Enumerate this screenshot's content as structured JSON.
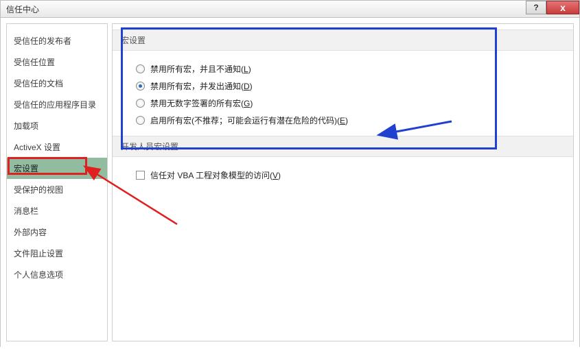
{
  "titlebar": {
    "title": "信任中心",
    "help": "?",
    "close": "x"
  },
  "sidebar": {
    "items": [
      {
        "label": "受信任的发布者"
      },
      {
        "label": "受信任位置"
      },
      {
        "label": "受信任的文档"
      },
      {
        "label": "受信任的应用程序目录"
      },
      {
        "label": "加载项"
      },
      {
        "label": "ActiveX 设置"
      },
      {
        "label": "宏设置"
      },
      {
        "label": "受保护的视图"
      },
      {
        "label": "消息栏"
      },
      {
        "label": "外部内容"
      },
      {
        "label": "文件阻止设置"
      },
      {
        "label": "个人信息选项"
      }
    ],
    "selected_index": 6
  },
  "macro_group": {
    "header": "宏设置",
    "options": [
      {
        "text": "禁用所有宏，并且不通知",
        "hotkey": "L"
      },
      {
        "text": "禁用所有宏，并发出通知",
        "hotkey": "D"
      },
      {
        "text": "禁用无数字签署的所有宏",
        "hotkey": "G"
      },
      {
        "text": "启用所有宏(不推荐；可能会运行有潜在危险的代码)",
        "hotkey": "E"
      }
    ],
    "selected_index": 1
  },
  "dev_group": {
    "header": "开发人员宏设置",
    "checkbox": {
      "text": "信任对 VBA 工程对象模型的访问",
      "hotkey": "V",
      "checked": false
    }
  }
}
